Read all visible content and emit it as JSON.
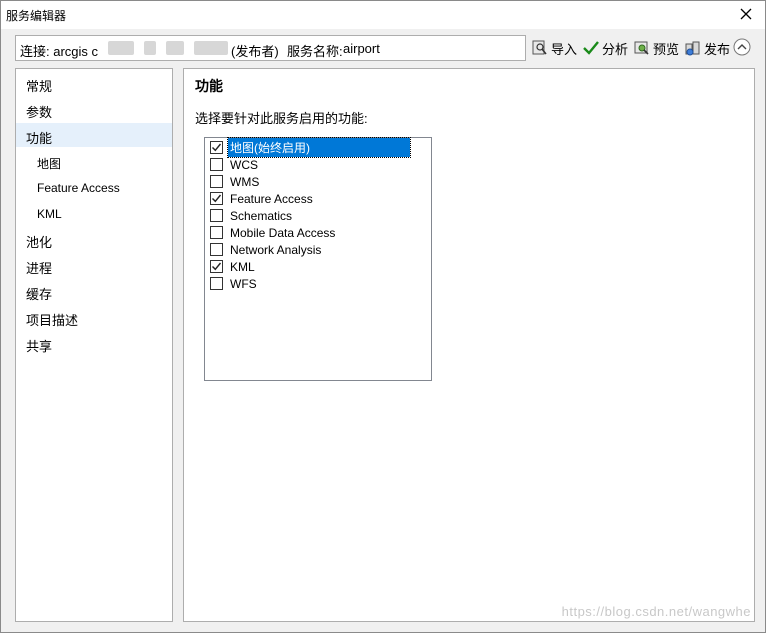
{
  "window": {
    "title": "服务编辑器"
  },
  "connection": {
    "prefix": "连接: arcgis c",
    "role": "(发布者)",
    "service_name_label": "服务名称:",
    "service_name": "airport"
  },
  "toolbar": {
    "import_label": "导入",
    "analyze_label": "分析",
    "preview_label": "预览",
    "publish_label": "发布"
  },
  "nav": {
    "items": [
      {
        "label": "常规"
      },
      {
        "label": "参数"
      },
      {
        "label": "功能"
      },
      {
        "label": "地图"
      },
      {
        "label": "Feature Access"
      },
      {
        "label": "KML"
      },
      {
        "label": "池化"
      },
      {
        "label": "进程"
      },
      {
        "label": "缓存"
      },
      {
        "label": "项目描述"
      },
      {
        "label": "共享"
      }
    ]
  },
  "panel": {
    "title": "功能",
    "instruction": "选择要针对此服务启用的功能:"
  },
  "capabilities": [
    {
      "label": "地图(始终启用)",
      "checked": true
    },
    {
      "label": "WCS",
      "checked": false
    },
    {
      "label": "WMS",
      "checked": false
    },
    {
      "label": "Feature Access",
      "checked": true
    },
    {
      "label": "Schematics",
      "checked": false
    },
    {
      "label": "Mobile Data Access",
      "checked": false
    },
    {
      "label": "Network Analysis",
      "checked": false
    },
    {
      "label": "KML",
      "checked": true
    },
    {
      "label": "WFS",
      "checked": false
    }
  ],
  "watermark": "https://blog.csdn.net/wangwhe",
  "colors": {
    "selection": "#0078d7",
    "nav_selected": "#e5f0fb",
    "check_green": "#1a8a1a"
  }
}
